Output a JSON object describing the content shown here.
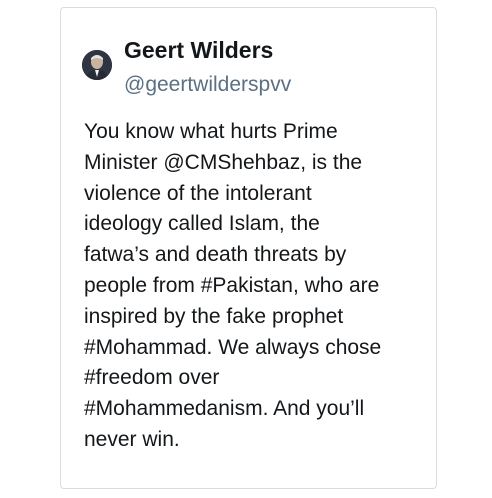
{
  "tweet": {
    "author_name": "Geert Wilders",
    "author_handle": "@geertwilderspvv",
    "avatar_icon": "profile-photo",
    "text_lines": [
      "You know what hurts Prime",
      "Minister @CMShehbaz, is the",
      "violence of the intolerant",
      "ideology called Islam, the",
      "fatwa’s and death threats by",
      "people from #Pakistan, who are",
      "inspired by the fake prophet",
      "#Mohammad. We always chose",
      "#freedom over",
      "#Mohammedanism. And you’ll",
      "never win."
    ]
  },
  "colors": {
    "text": "#14171a",
    "handle": "#5b7083",
    "border": "#d8dde2"
  }
}
